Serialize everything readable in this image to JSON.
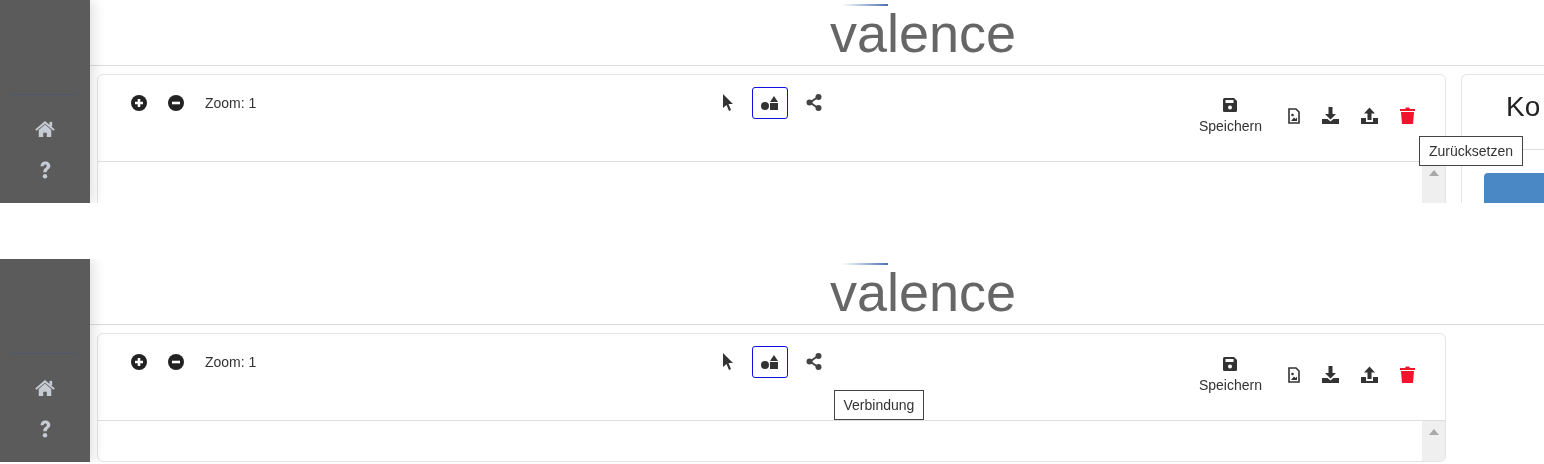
{
  "screens": [
    {
      "logo": "valence",
      "zoom_label": "Zoom: 1",
      "tools": [
        {
          "kind": "pointer",
          "selected": false
        },
        {
          "kind": "shapes",
          "selected": true
        },
        {
          "kind": "connect",
          "selected": false
        }
      ],
      "save_label": "Speichern",
      "actions": [
        {
          "kind": "export-image"
        },
        {
          "kind": "download"
        },
        {
          "kind": "upload"
        },
        {
          "kind": "reset",
          "tooltip": "Zurücksetzen"
        }
      ],
      "side_panel": {
        "title": "Ko"
      }
    },
    {
      "logo": "valence",
      "zoom_label": "Zoom: 1",
      "tools": [
        {
          "kind": "pointer",
          "selected": false
        },
        {
          "kind": "shapes",
          "selected": true
        },
        {
          "kind": "connect",
          "selected": false,
          "tooltip": "Verbindung"
        }
      ],
      "save_label": "Speichern",
      "actions": [
        {
          "kind": "export-image"
        },
        {
          "kind": "download"
        },
        {
          "kind": "upload"
        },
        {
          "kind": "reset"
        }
      ]
    }
  ]
}
